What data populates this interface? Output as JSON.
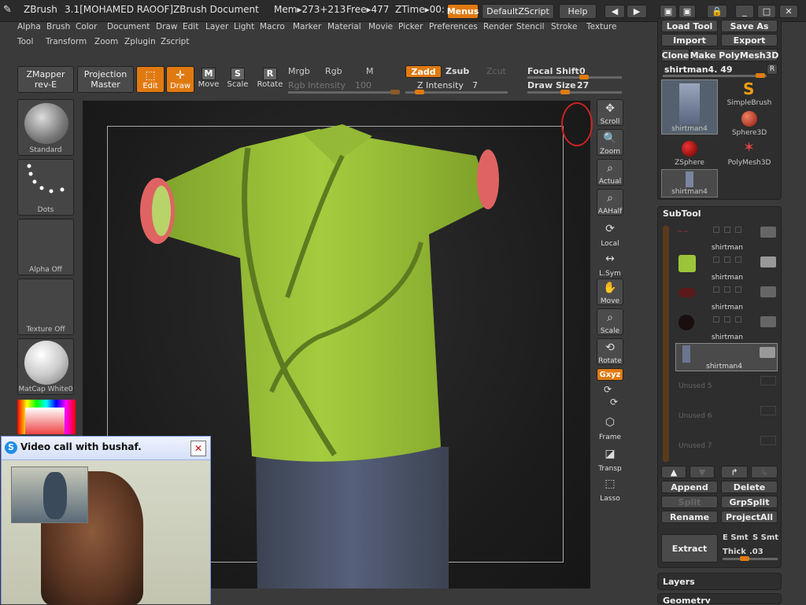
{
  "titlebar": {
    "app": "ZBrush",
    "version": "3.1[MOHAMED RAOOF]",
    "document": "ZBrush Document",
    "mem": "Mem▸273+213",
    "free": "Free▸477",
    "ztime": "ZTime▸00:",
    "menus_label": "Menus",
    "zscript_label": "DefaultZScript",
    "help_label": "Help"
  },
  "menu": {
    "row1": [
      "Alpha",
      "Brush",
      "Color",
      "Document",
      "Draw",
      "Edit",
      "Layer",
      "Light",
      "Macro",
      "Marker",
      "Material",
      "Movie",
      "Picker",
      "Preferences",
      "Render",
      "Stencil",
      "Stroke",
      "Texture"
    ],
    "row2": [
      "Tool",
      "Transform",
      "Zoom",
      "Zplugin",
      "Zscript"
    ]
  },
  "toolbar": {
    "zmapper": "ZMapper",
    "zmapper_sub": "rev-E",
    "projection": "Projection",
    "projection_sub": "Master",
    "edit": "Edit",
    "draw": "Draw",
    "move": "Move",
    "scale": "Scale",
    "rotate": "Rotate",
    "mrgb": "Mrgb",
    "rgb": "Rgb",
    "m": "M",
    "rgb_intensity_label": "Rgb Intensity",
    "rgb_intensity_value": "100",
    "zadd": "Zadd",
    "zsub": "Zsub",
    "zcut": "Zcut",
    "z_intensity_label": "Z Intensity",
    "z_intensity_value": "7",
    "focal_shift_label": "Focal Shift",
    "focal_shift_value": "0",
    "draw_size_label": "Draw Size",
    "draw_size_value": "27"
  },
  "left_panel": {
    "standard": "Standard",
    "dots": "Dots",
    "alpha": "Alpha Off",
    "texture": "Texture Off",
    "matcap": "MatCap White0"
  },
  "right_bar": [
    "Scroll",
    "Zoom",
    "Actual",
    "AAHalf",
    "Local",
    "L.Sym",
    "Move",
    "Scale",
    "Rotate",
    "Frame",
    "Transp",
    "Lasso"
  ],
  "right_bar_xyz": "Gxyz",
  "tool_panel": {
    "load_tool": "Load Tool",
    "save_as": "Save As",
    "import": "Import",
    "export": "Export",
    "clone": "Clone",
    "make_polymesh": "Make PolyMesh3D",
    "current_tool": "shirtman4. 49",
    "r_button": "R",
    "tools": [
      {
        "name": "shirtman4"
      },
      {
        "name": "SimpleBrush"
      },
      {
        "name": "Sphere3D"
      },
      {
        "name": "ZSphere"
      },
      {
        "name": "PolyMesh3D"
      },
      {
        "name": "shirtman4"
      }
    ]
  },
  "subtool": {
    "header": "SubTool",
    "items": [
      "shirtman",
      "shirtman",
      "shirtman",
      "shirtman",
      "shirtman4"
    ],
    "unused": [
      "Unused 5",
      "Unused 6",
      "Unused 7"
    ],
    "append": "Append",
    "delete": "Delete",
    "split": "Split",
    "grpsplit": "GrpSplit",
    "rename": "Rename",
    "projectall": "ProjectAll",
    "extract": "Extract",
    "e_smt": "E Smt",
    "s_smt": "S Smt",
    "thick_label": "Thick",
    "thick_value": ".03"
  },
  "layers_label": "Layers",
  "geometry_label": "Geometry",
  "skype": {
    "title": "Video call with bushaf."
  },
  "colors": {
    "accent": "#e07a10",
    "shirt": "#9cc43a",
    "cuff": "#e06060",
    "jeans": "#4a5466"
  }
}
